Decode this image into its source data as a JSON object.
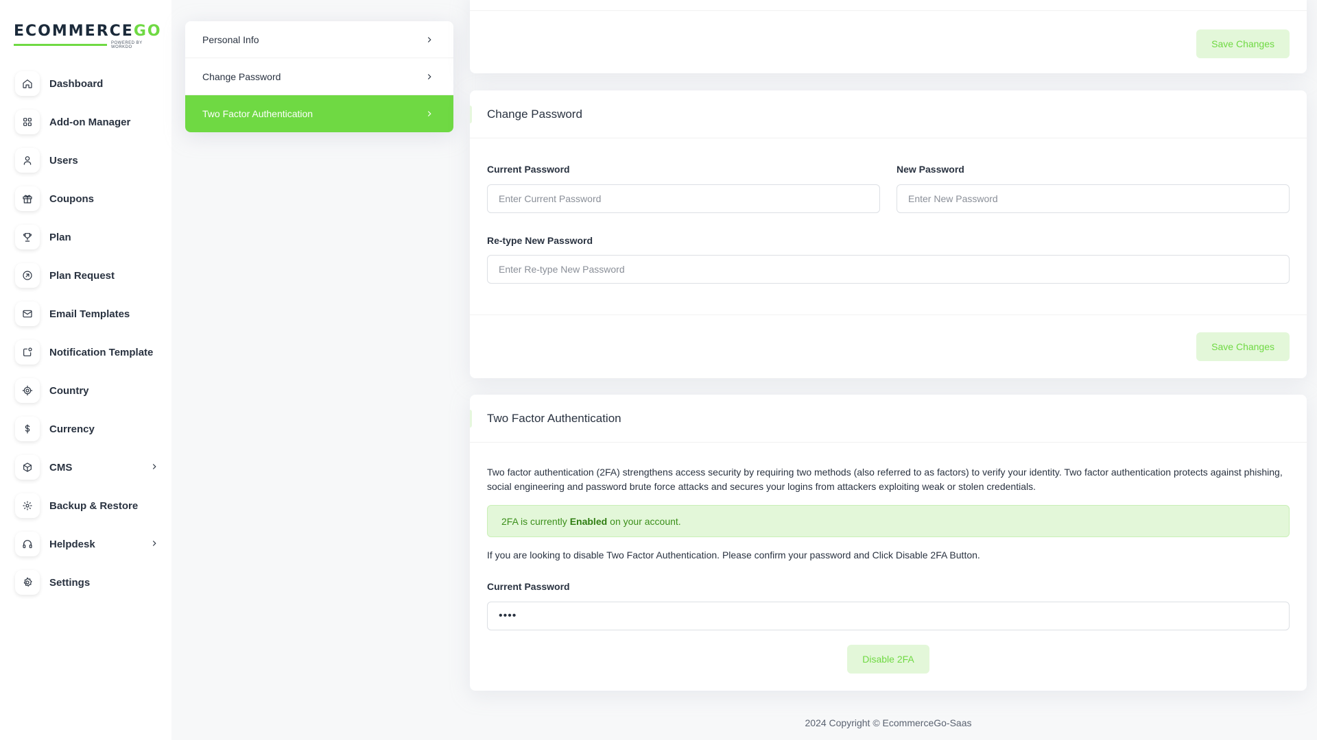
{
  "logo": {
    "main": "ECOMMERCE",
    "accent": "GO",
    "sub": "POWERED BY WORKDO"
  },
  "sidebar": {
    "items": [
      {
        "label": "Dashboard",
        "icon": "home-icon"
      },
      {
        "label": "Add-on Manager",
        "icon": "apps-icon"
      },
      {
        "label": "Users",
        "icon": "user-icon"
      },
      {
        "label": "Coupons",
        "icon": "gift-icon"
      },
      {
        "label": "Plan",
        "icon": "trophy-icon"
      },
      {
        "label": "Plan Request",
        "icon": "arrow-circle-icon"
      },
      {
        "label": "Email Templates",
        "icon": "mail-icon"
      },
      {
        "label": "Notification Template",
        "icon": "notification-icon"
      },
      {
        "label": "Country",
        "icon": "target-icon"
      },
      {
        "label": "Currency",
        "icon": "dollar-icon"
      },
      {
        "label": "CMS",
        "icon": "package-icon",
        "has_submenu": true
      },
      {
        "label": "Backup & Restore",
        "icon": "backup-icon"
      },
      {
        "label": "Helpdesk",
        "icon": "headset-icon",
        "has_submenu": true
      },
      {
        "label": "Settings",
        "icon": "gear-icon"
      }
    ]
  },
  "tabs": [
    {
      "label": "Personal Info"
    },
    {
      "label": "Change Password"
    },
    {
      "label": "Two Factor Authentication",
      "active": true
    }
  ],
  "top_card": {
    "save_label": "Save Changes"
  },
  "change_password": {
    "title": "Change Password",
    "current_label": "Current Password",
    "current_placeholder": "Enter Current Password",
    "new_label": "New Password",
    "new_placeholder": "Enter New Password",
    "retype_label": "Re-type New Password",
    "retype_placeholder": "Enter Re-type New Password",
    "save_label": "Save Changes"
  },
  "two_factor": {
    "title": "Two Factor Authentication",
    "description": "Two factor authentication (2FA) strengthens access security by requiring two methods (also referred to as factors) to verify your identity. Two factor authentication protects against phishing, social engineering and password brute force attacks and secures your logins from attackers exploiting weak or stolen credentials.",
    "status_prefix": "2FA is currently",
    "status_value": "Enabled",
    "status_suffix": "on your account.",
    "disable_info": "If you are looking to disable Two Factor Authentication. Please confirm your password and Click Disable 2FA Button.",
    "password_label": "Current Password",
    "password_value": "••••",
    "disable_label": "Disable 2FA"
  },
  "footer": {
    "text": "2024 Copyright © EcommerceGo-Saas"
  },
  "colors": {
    "accent": "#6fd943",
    "accent_soft": "#e3f7d9",
    "text": "#293240"
  }
}
